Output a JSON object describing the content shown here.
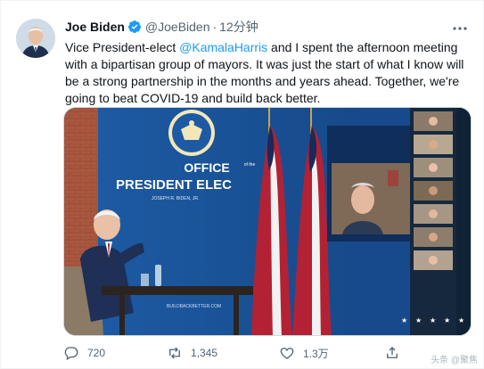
{
  "author": {
    "display_name": "Joe Biden",
    "handle": "@JoeBiden",
    "separator": "·",
    "timestamp": "12分钟",
    "verified_icon": "verified-badge-icon"
  },
  "tweet": {
    "text_before": "Vice President-elect ",
    "mention": "@KamalaHarris",
    "text_after": " and I spent the afternoon meeting with a bipartisan group of mayors. It was just the start of what I know will be a strong partnership in the months and years ahead. Together, we're going to beat COVID-19 and build back better."
  },
  "media": {
    "sign_line1": "OFFICE",
    "sign_of_the": "of the",
    "sign_line2": "PRESIDENT ELEC",
    "sign_sub": "JOSEPH R. BIDEN, JR.",
    "podium_text": "BUILDBACKBETTER.COM",
    "colors": {
      "backdrop": "#1a4f93",
      "seal": "#f3e6b8",
      "wall": "#b05a45"
    }
  },
  "actions": {
    "reply": {
      "icon": "reply-icon",
      "count": "720"
    },
    "retweet": {
      "icon": "retweet-icon",
      "count": "1,345"
    },
    "like": {
      "icon": "like-icon",
      "count": "1.3万"
    },
    "share": {
      "icon": "share-icon"
    }
  },
  "watermark": "头条 @聚焦"
}
